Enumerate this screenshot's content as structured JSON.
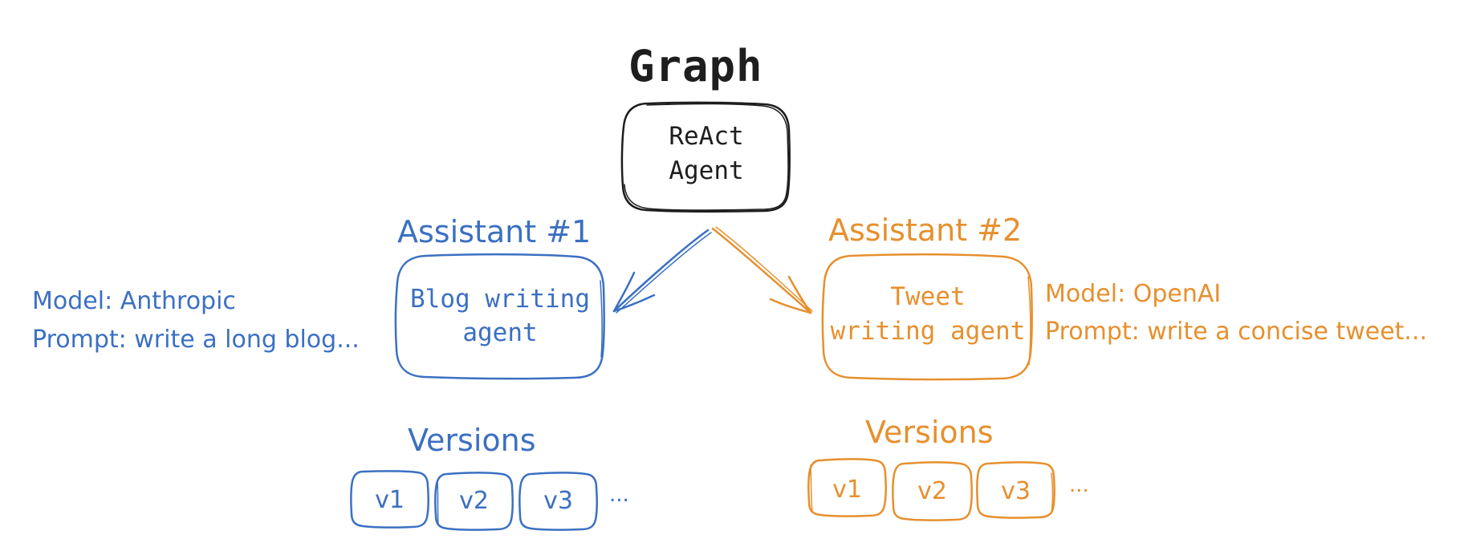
{
  "diagram": {
    "title": "Graph",
    "root_node": {
      "label_line1": "ReAct",
      "label_line2": "Agent",
      "color": "#1e1e1e"
    },
    "assistants": [
      {
        "heading": "Assistant #1",
        "node": {
          "label_line1": "Blog writing",
          "label_line2": "agent"
        },
        "model": "Model: Anthropic",
        "prompt": "Prompt: write a long blog...",
        "versions_heading": "Versions",
        "versions": [
          "v1",
          "v2",
          "v3"
        ],
        "more": "...",
        "color": "#3b70c2"
      },
      {
        "heading": "Assistant #2",
        "node": {
          "label_line1": "Tweet",
          "label_line2": "writing agent"
        },
        "model": "Model: OpenAI",
        "prompt": "Prompt: write a concise tweet...",
        "versions_heading": "Versions",
        "versions": [
          "v1",
          "v2",
          "v3"
        ],
        "more": "...",
        "color": "#e6902e"
      }
    ],
    "edges": [
      {
        "from": "ReAct Agent",
        "to": "Blog writing agent"
      },
      {
        "from": "ReAct Agent",
        "to": "Tweet writing agent"
      }
    ]
  }
}
